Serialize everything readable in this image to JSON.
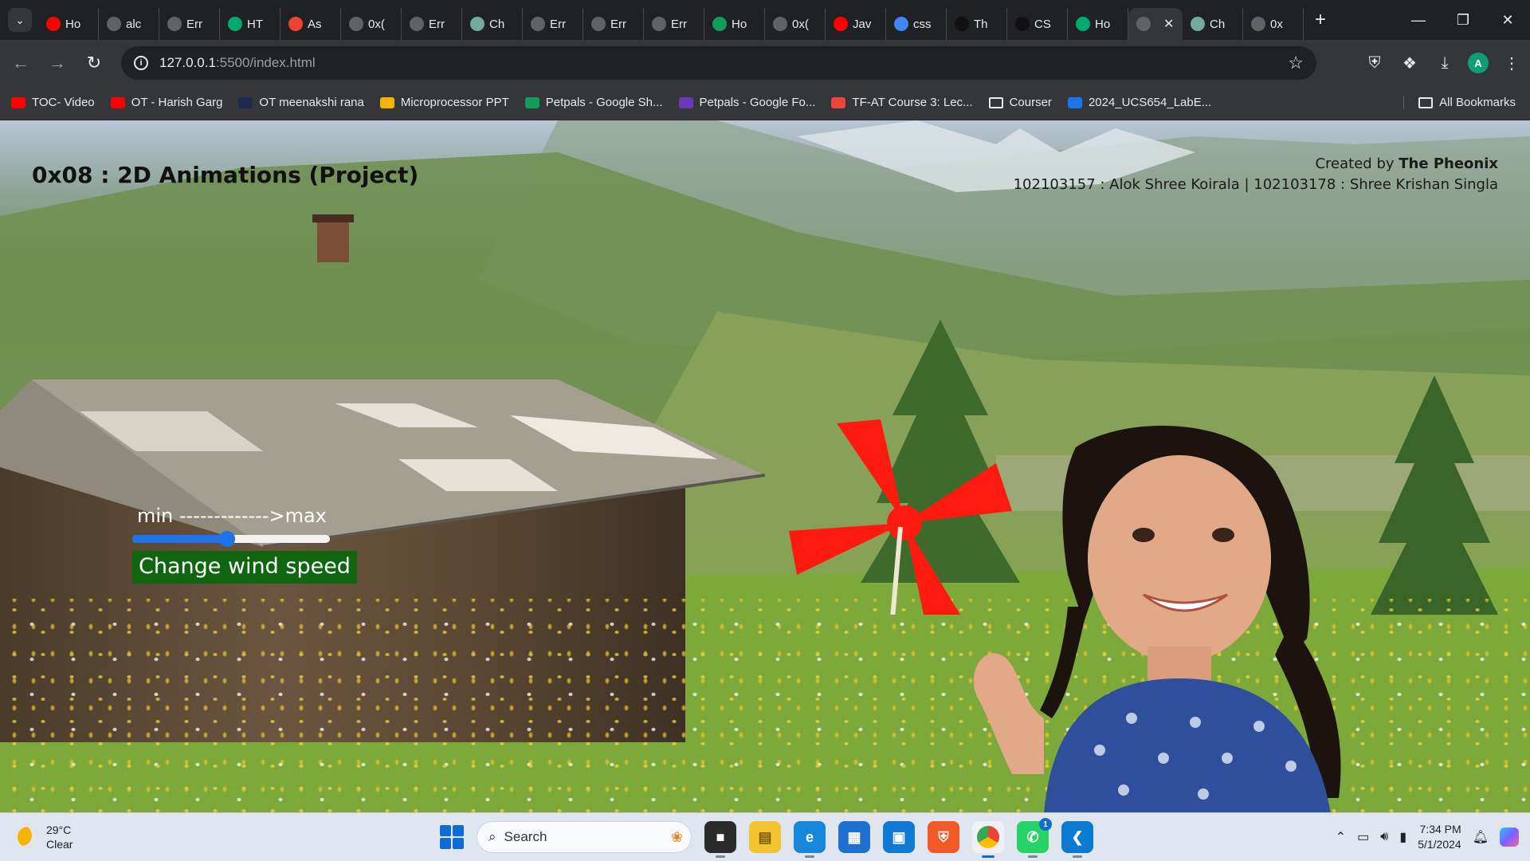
{
  "browser": {
    "tabs": [
      {
        "label": "Ho",
        "icon": "youtube-icon",
        "color": "#ff0000"
      },
      {
        "label": "alc",
        "icon": "github-icon",
        "color": "#5f6368"
      },
      {
        "label": "Err",
        "icon": "globe-icon",
        "color": "#5f6368"
      },
      {
        "label": "HT",
        "icon": "w3schools-icon",
        "color": "#04aa6d"
      },
      {
        "label": "As",
        "icon": "gmail-icon",
        "color": "#ea4335"
      },
      {
        "label": "0x(",
        "icon": "github-icon",
        "color": "#5f6368"
      },
      {
        "label": "Err",
        "icon": "globe-icon",
        "color": "#5f6368"
      },
      {
        "label": "Ch",
        "icon": "chatgpt-icon",
        "color": "#74aa9c"
      },
      {
        "label": "Err",
        "icon": "globe-icon",
        "color": "#5f6368"
      },
      {
        "label": "Err",
        "icon": "globe-icon",
        "color": "#5f6368"
      },
      {
        "label": "Err",
        "icon": "globe-icon",
        "color": "#5f6368"
      },
      {
        "label": "Ho",
        "icon": "infinity-icon",
        "color": "#0f9d58"
      },
      {
        "label": "0x(",
        "icon": "globe-icon",
        "color": "#5f6368"
      },
      {
        "label": "Jav",
        "icon": "youtube-icon",
        "color": "#ff0000"
      },
      {
        "label": "css",
        "icon": "google-icon",
        "color": "#4285f4"
      },
      {
        "label": "Th",
        "icon": "codepen-icon",
        "color": "#111111"
      },
      {
        "label": "CS",
        "icon": "codepen-icon",
        "color": "#111111"
      },
      {
        "label": "Ho",
        "icon": "w3schools-icon",
        "color": "#04aa6d"
      },
      {
        "label": "",
        "icon": "globe-icon",
        "color": "#5f6368",
        "active": true
      },
      {
        "label": "Ch",
        "icon": "chatgpt-icon",
        "color": "#74aa9c"
      },
      {
        "label": "0x",
        "icon": "github-icon",
        "color": "#5f6368"
      }
    ],
    "url_host": "127.0.0.1",
    "url_path": ":5500/index.html",
    "profile_initial": "A",
    "bookmarks": [
      {
        "label": "TOC- Video",
        "color": "#ff0000"
      },
      {
        "label": "OT - Harish Garg",
        "color": "#ff0000"
      },
      {
        "label": "OT meenakshi rana",
        "color": "#1e2a4a"
      },
      {
        "label": "Microprocessor PPT",
        "color": "#f4b400"
      },
      {
        "label": "Petpals - Google Sh...",
        "color": "#0f9d58"
      },
      {
        "label": "Petpals - Google Fo...",
        "color": "#673ab7"
      },
      {
        "label": "TF-AT Course 3: Lec...",
        "color": "#e8453c"
      },
      {
        "label": "Courser",
        "color": "folder"
      },
      {
        "label": "2024_UCS654_LabE...",
        "color": "#1a73e8"
      }
    ],
    "all_bookmarks_label": "All Bookmarks"
  },
  "page": {
    "title": "0x08 : 2D Animations (Project)",
    "credits_prefix": "Created by ",
    "team_name": "The Pheonix",
    "members_line": "102103157 : Alok Shree Koirala  |   102103178 : Shree Krishan Singla",
    "range_label": "min ------------->max",
    "wind_button_label": "Change wind speed",
    "wind_speed_fraction": 0.48,
    "pinwheel_color": "#ff1a0f"
  },
  "taskbar": {
    "temperature": "29°C",
    "weather": "Clear",
    "search_placeholder": "Search",
    "time": "7:34 PM",
    "date": "5/1/2024",
    "whatsapp_badge": "1"
  }
}
